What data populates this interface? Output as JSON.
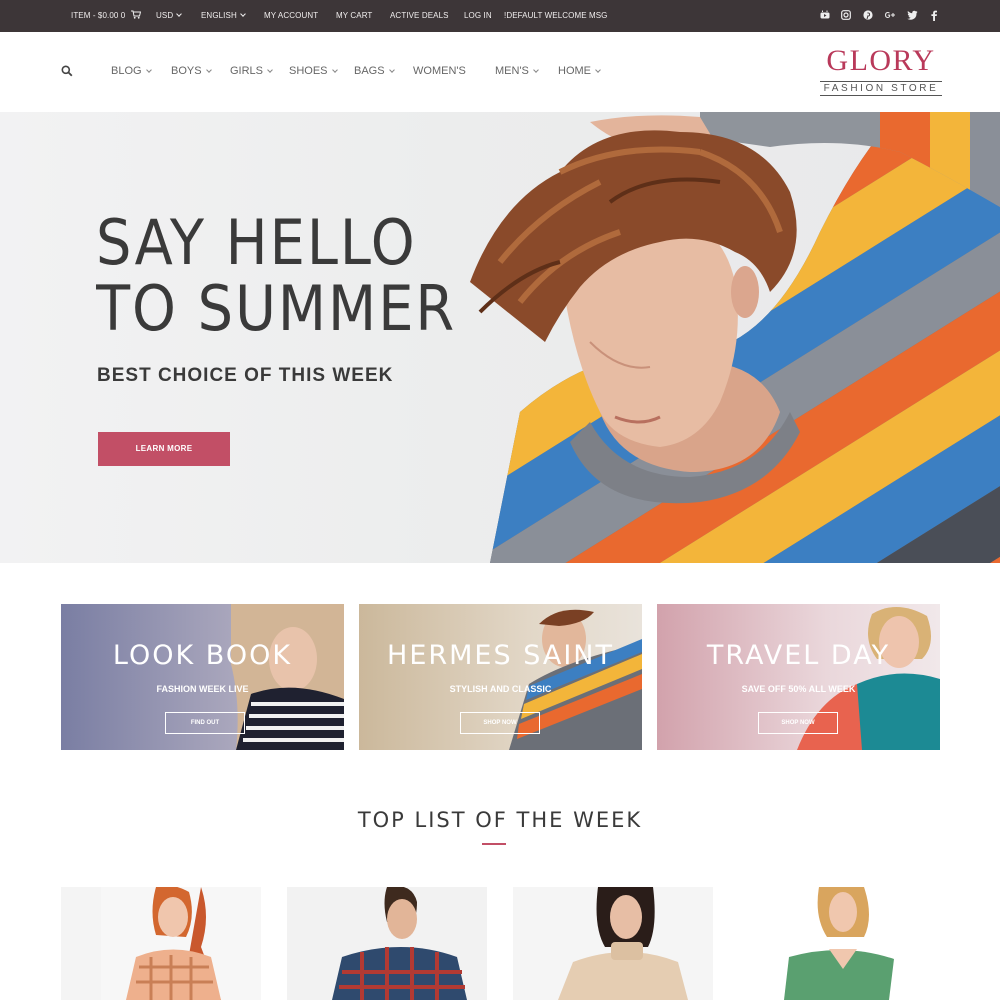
{
  "topbar": {
    "cart_summary": "ITEM - $0.00 0",
    "currency": "USD",
    "language": "ENGLISH",
    "links": [
      "MY ACCOUNT",
      "MY CART",
      "ACTIVE DEALS",
      "LOG IN",
      "!DEFAULT WELCOME MSG"
    ],
    "social_icons": [
      "youtube-icon",
      "instagram-icon",
      "pinterest-icon",
      "google-plus-icon",
      "twitter-icon",
      "facebook-icon"
    ]
  },
  "nav": {
    "items": [
      "BLOG",
      "BOYS",
      "GIRLS",
      "SHOES",
      "BAGS",
      "WOMEN'S",
      "MEN'S",
      "HOME"
    ]
  },
  "logo": {
    "title": "GLORY",
    "subtitle": "FASHION STORE"
  },
  "hero": {
    "line1": "SAY HELLO",
    "line2": "TO SUMMER",
    "subtitle": "BEST CHOICE OF THIS WEEK",
    "button": "LEARN MORE"
  },
  "banners": [
    {
      "title": "LOOK BOOK",
      "subtitle": "FASHION WEEK LIVE",
      "button": "FIND OUT"
    },
    {
      "title": "HERMES SAINT",
      "subtitle": "STYLISH AND CLASSIC",
      "button": "SHOP NOW"
    },
    {
      "title": "TRAVEL DAY",
      "subtitle": "SAVE OFF 50% ALL WEEK",
      "button": "SHOP NOW"
    }
  ],
  "section": {
    "title": "TOP LIST OF THE WEEK"
  },
  "colors": {
    "accent": "#c24f66",
    "topbar": "#3d3638",
    "logo": "#b9395a"
  }
}
